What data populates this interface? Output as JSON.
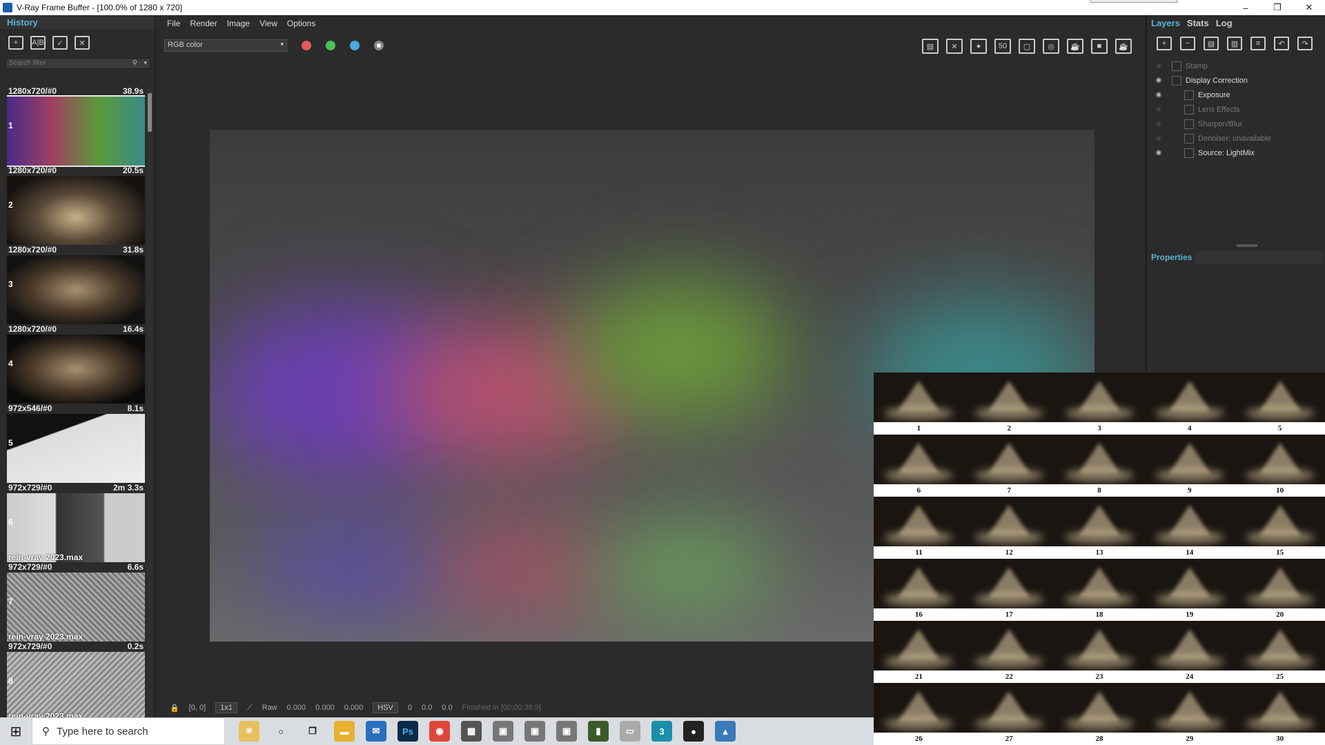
{
  "window": {
    "title": "V-Ray Frame Buffer - [100.0% of 1280 x 720]",
    "minimize": "–",
    "restore": "❐",
    "close": "✕"
  },
  "history": {
    "tab": "History",
    "search_placeholder": "Search filter",
    "items": [
      {
        "res": "1280x720/#0",
        "time": "38.9s",
        "num": "1",
        "file": ""
      },
      {
        "res": "1280x720/#0",
        "time": "20.5s",
        "num": "2",
        "file": ""
      },
      {
        "res": "1280x720/#0",
        "time": "31.8s",
        "num": "3",
        "file": ""
      },
      {
        "res": "1280x720/#0",
        "time": "16.4s",
        "num": "4",
        "file": ""
      },
      {
        "res": "972x546/#0",
        "time": "8.1s",
        "num": "5",
        "file": ""
      },
      {
        "res": "972x729/#0",
        "time": "2m 3.3s",
        "num": "6",
        "file": "rein-vray 2023.max"
      },
      {
        "res": "972x729/#0",
        "time": "6.6s",
        "num": "7",
        "file": "rein-vray 2023.max"
      },
      {
        "res": "972x729/#0",
        "time": "0.2s",
        "num": "8",
        "file": "rein-vray 2023.max"
      }
    ]
  },
  "menu": {
    "file": "File",
    "render": "Render",
    "image": "Image",
    "view": "View",
    "options": "Options"
  },
  "toolbar": {
    "channel": "RGB color",
    "colors": {
      "red": "#e05a5a",
      "green": "#4cc05a",
      "blue": "#4aa8e0"
    }
  },
  "status": {
    "coords": "[0, 0]",
    "zoom": "1x1",
    "raw": "Raw",
    "v1": "0.000",
    "v2": "0.000",
    "v3": "0.000",
    "mode": "HSV",
    "h": "0",
    "s": "0.0",
    "v": "0.0",
    "finished": "Finished in [00:00:38.9]"
  },
  "right": {
    "tabs": {
      "layers": "Layers",
      "stats": "Stats",
      "log": "Log"
    },
    "layers": [
      {
        "name": "Stamp",
        "dim": true,
        "indent": 0
      },
      {
        "name": "Display Correction",
        "dim": false,
        "indent": 0
      },
      {
        "name": "Exposure",
        "dim": false,
        "indent": 1
      },
      {
        "name": "Lens Effects",
        "dim": true,
        "indent": 1
      },
      {
        "name": "Sharpen/Blur",
        "dim": true,
        "indent": 1
      },
      {
        "name": "Denoiser: unavailable",
        "dim": true,
        "indent": 1
      },
      {
        "name": "Source: LightMix",
        "dim": false,
        "indent": 1
      }
    ],
    "properties": "Properties"
  },
  "grid_labels": [
    "1",
    "2",
    "3",
    "4",
    "5",
    "6",
    "7",
    "8",
    "9",
    "10",
    "11",
    "12",
    "13",
    "14",
    "15",
    "16",
    "17",
    "18",
    "19",
    "20",
    "21",
    "22",
    "23",
    "24",
    "25",
    "26",
    "27",
    "28",
    "29",
    "30"
  ],
  "taskbar": {
    "search": "Type here to search"
  }
}
